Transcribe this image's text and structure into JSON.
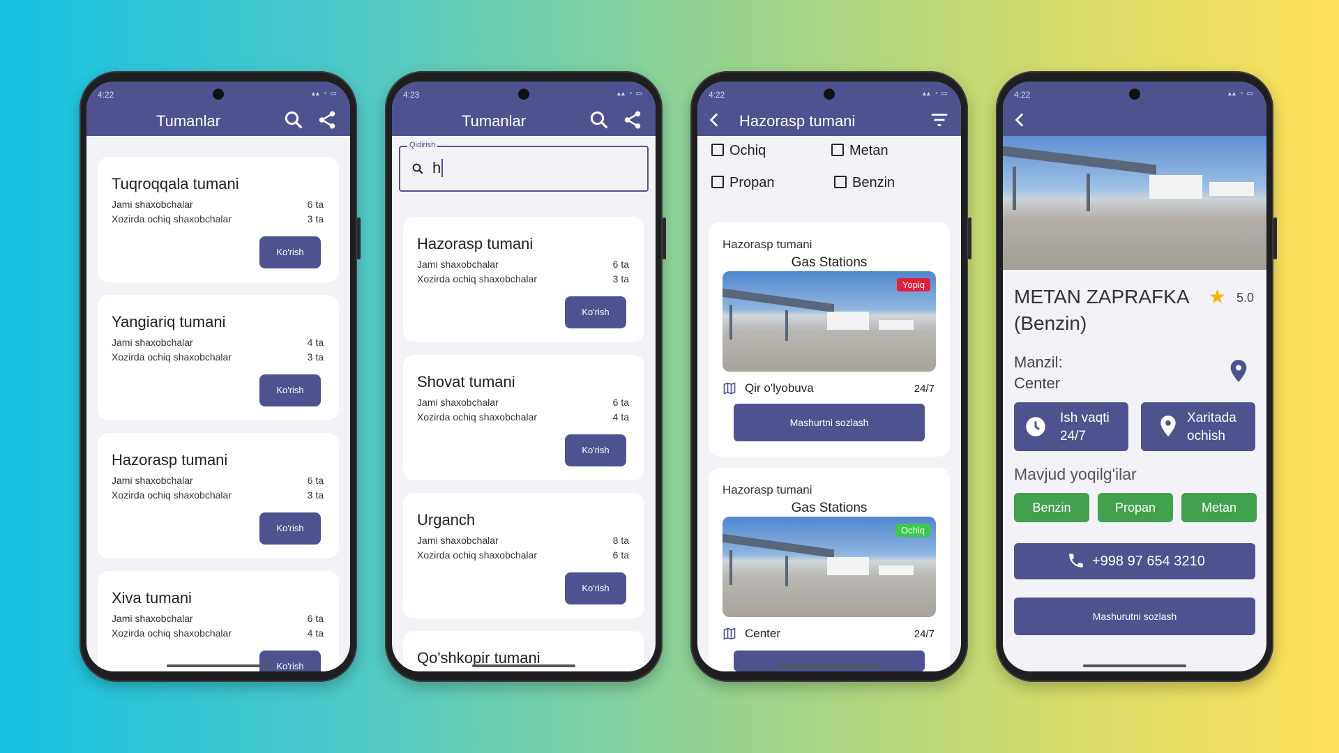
{
  "common": {
    "district_stat_total": "Jami shaxobchalar",
    "district_stat_open": "Xozirda ochiq shaxobchalar",
    "view_button": "Ko'rish"
  },
  "screen1": {
    "time": "4:22",
    "title": "Tumanlar",
    "districts": [
      {
        "name": "Tuqroqqala tumani",
        "total": "6 ta",
        "open": "3 ta"
      },
      {
        "name": "Yangiariq tumani",
        "total": "4 ta",
        "open": "3 ta"
      },
      {
        "name": "Hazorasp tumani",
        "total": "6 ta",
        "open": "3 ta"
      },
      {
        "name": "Xiva tumani",
        "total": "6 ta",
        "open": "4 ta"
      }
    ]
  },
  "screen2": {
    "time": "4:23",
    "title": "Tumanlar",
    "search_label": "Qidirish",
    "search_value": "h",
    "districts": [
      {
        "name": "Hazorasp tumani",
        "total": "6 ta",
        "open": "3 ta"
      },
      {
        "name": "Shovat tumani",
        "total": "6 ta",
        "open": "4 ta"
      },
      {
        "name": "Urganch",
        "total": "8 ta",
        "open": "6 ta"
      },
      {
        "name": "Qo'shkopir tumani"
      }
    ]
  },
  "screen3": {
    "time": "4:22",
    "title": "Hazorasp tumani",
    "filters": [
      "Ochiq",
      "Metan",
      "Propan",
      "Benzin"
    ],
    "stations": [
      {
        "district": "Hazorasp tumani",
        "category": "Gas Stations",
        "status": "Yopiq",
        "status_color": "#e0203c",
        "location": "Qir o'lyobuva",
        "hours": "24/7",
        "button": "Mashurtni sozlash"
      },
      {
        "district": "Hazorasp tumani",
        "category": "Gas Stations",
        "status": "Ochiq",
        "status_color": "#3cc94d",
        "location": "Center",
        "hours": "24/7"
      }
    ]
  },
  "screen4": {
    "time": "4:22",
    "name": "METAN ZAPRAFKA (Benzin)",
    "rating": "5.0",
    "address_label": "Manzil:",
    "address_value": "Center",
    "hours_button": {
      "label": "Ish vaqti",
      "value": "24/7"
    },
    "map_button": {
      "label": "Xaritada",
      "value": "ochish"
    },
    "fuels_title": "Mavjud yoqilg'ilar",
    "fuels": [
      "Benzin",
      "Propan",
      "Metan"
    ],
    "phone": "+998 97 654 3210",
    "route_button": "Mashurutni sozlash"
  },
  "colors": {
    "primary": "#4e5390",
    "fuel_green": "#41a14e",
    "closed_red": "#e0203c",
    "open_green": "#3cc94d",
    "star": "#f5b400"
  }
}
